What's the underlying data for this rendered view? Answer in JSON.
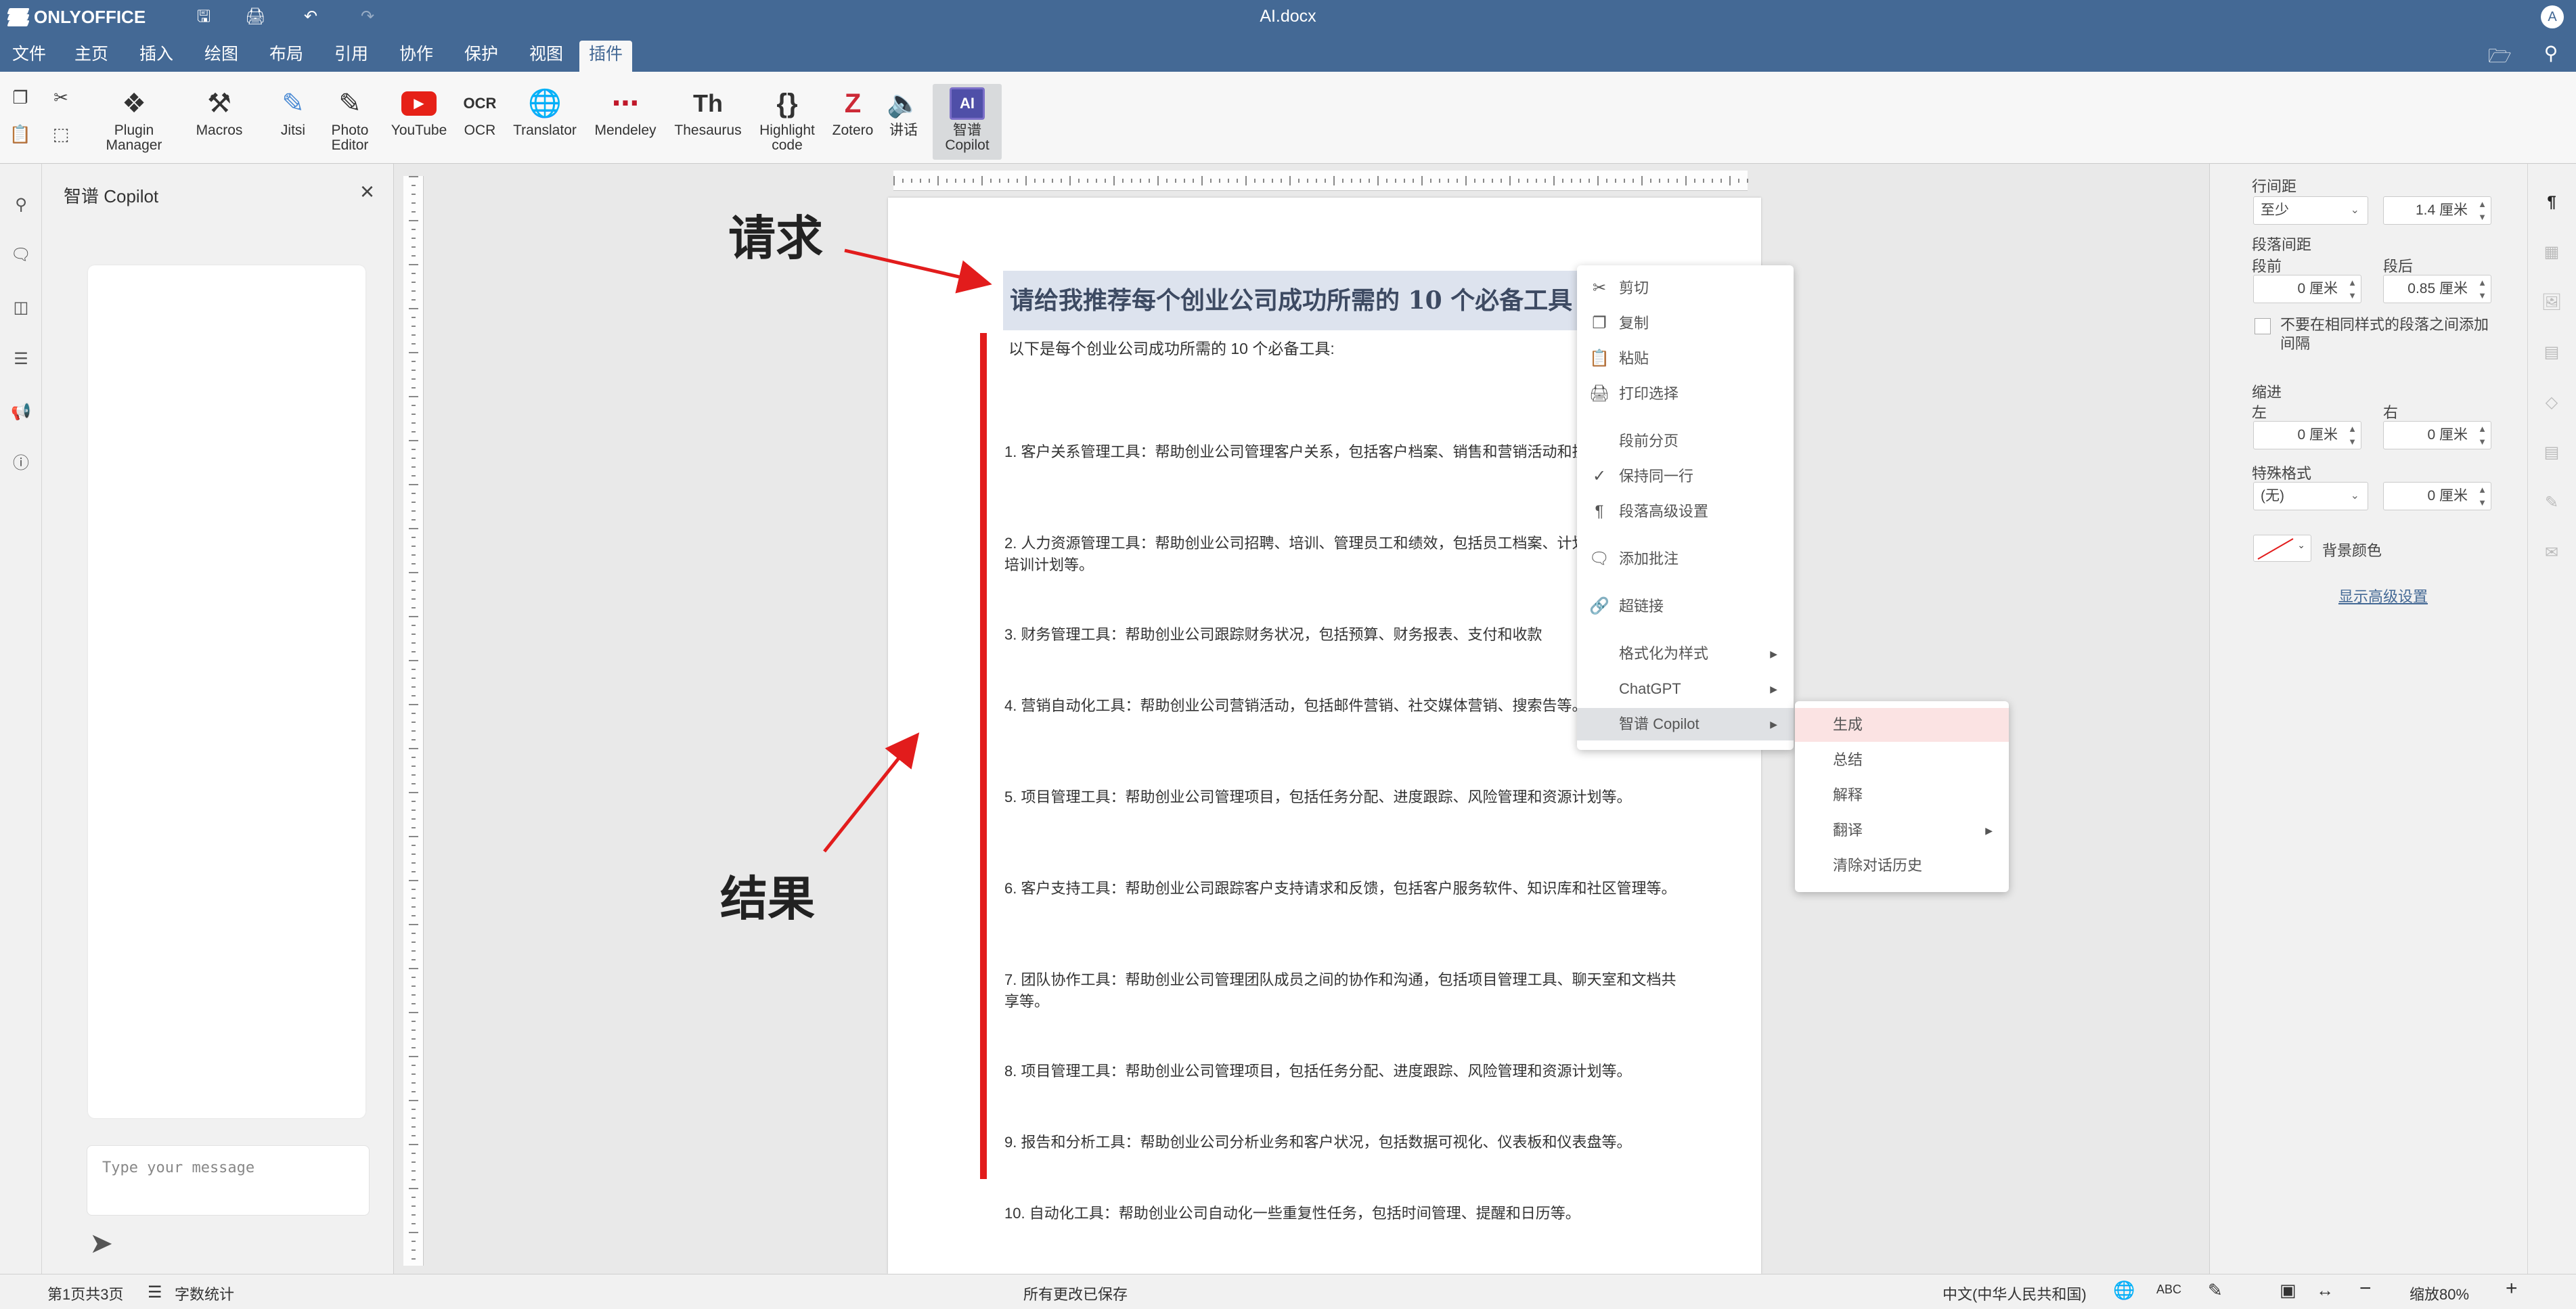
{
  "app": {
    "logo": "ONLYOFFICE",
    "doc_title": "AI.docx",
    "avatar": "A"
  },
  "quick_access": {
    "save_icon": "save-icon",
    "print_icon": "print-icon",
    "undo_icon": "undo-icon",
    "redo_icon": "redo-icon"
  },
  "menu_tabs": [
    "文件",
    "主页",
    "插入",
    "绘图",
    "布局",
    "引用",
    "协作",
    "保护",
    "视图",
    "插件"
  ],
  "active_tab": "插件",
  "toolbar": {
    "plugin_manager": "Plugin Manager",
    "macros": "Macros",
    "jitsi": "Jitsi",
    "photo_editor": "Photo Editor",
    "youtube": "YouTube",
    "ocr": "OCR",
    "translator": "Translator",
    "mendeley": "Mendeley",
    "thesaurus": "Thesaurus",
    "highlight_code": "Highlight code",
    "zotero": "Zotero",
    "speech": "讲话",
    "copilot": "智谱 Copilot",
    "ocr_glyph": "OCR",
    "th_glyph": "Th",
    "braces_glyph": "{}",
    "z_glyph": "Z",
    "ai_glyph": "AI"
  },
  "copilot_panel": {
    "title": "智谱 Copilot",
    "input_placeholder": "Type your message"
  },
  "document": {
    "heading": "请给我推荐每个创业公司成功所需的 10 个必备工具",
    "intro": "以下是每个创业公司成功所需的 10 个必备工具:",
    "items": [
      "1. 客户关系管理工具：帮助创业公司管理客户关系，包括客户档案、销售和营销活动和投诉等。",
      "2. 人力资源管理工具：帮助创业公司招聘、培训、管理员工和绩效，包括员工档案、计划、绩效评估和培训计划等。",
      "3. 财务管理工具：帮助创业公司跟踪财务状况，包括预算、财务报表、支付和收款",
      "4. 营销自动化工具：帮助创业公司营销活动，包括邮件营销、社交媒体营销、搜索告等。",
      "5. 项目管理工具：帮助创业公司管理项目，包括任务分配、进度跟踪、风险管理和资源计划等。",
      "6. 客户支持工具：帮助创业公司跟踪客户支持请求和反馈，包括客户服务软件、知识库和社区管理等。",
      "7. 团队协作工具：帮助创业公司管理团队成员之间的协作和沟通，包括项目管理工具、聊天室和文档共享等。",
      "8. 项目管理工具：帮助创业公司管理项目，包括任务分配、进度跟踪、风险管理和资源计划等。",
      "9. 报告和分析工具：帮助创业公司分析业务和客户状况，包括数据可视化、仪表板和仪表盘等。",
      "10. 自动化工具：帮助创业公司自动化一些重复性任务，包括时间管理、提醒和日历等。"
    ]
  },
  "annotations": {
    "request": "请求",
    "result": "结果",
    "color": "#e21c1c"
  },
  "context_menu": {
    "items": [
      {
        "label": "剪切",
        "icon": "scissors-icon"
      },
      {
        "label": "复制",
        "icon": "copy-icon"
      },
      {
        "label": "粘贴",
        "icon": "paste-icon"
      },
      {
        "label": "打印选择",
        "icon": "print-icon"
      },
      {
        "label": "段前分页",
        "icon": ""
      },
      {
        "label": "保持同一行",
        "icon": "check-icon"
      },
      {
        "label": "段落高级设置",
        "icon": "paragraph-icon"
      },
      {
        "label": "添加批注",
        "icon": "comment-icon"
      },
      {
        "label": "超链接",
        "icon": "link-icon"
      },
      {
        "label": "格式化为样式",
        "icon": ""
      },
      {
        "label": "ChatGPT",
        "icon": ""
      },
      {
        "label": "智谱 Copilot",
        "icon": ""
      }
    ]
  },
  "submenu": {
    "items": [
      "生成",
      "总结",
      "解释",
      "翻译",
      "清除对话历史"
    ]
  },
  "right_panel": {
    "line_spacing_label": "行间距",
    "line_spacing_mode": "至少",
    "line_spacing_value": "1.4 厘米",
    "para_spacing_label": "段落间距",
    "before_label": "段前",
    "after_label": "段后",
    "before_value": "0 厘米",
    "after_value": "0.85 厘米",
    "no_space_same_style": "不要在相同样式的段落之间添加间隔",
    "indent_label": "缩进",
    "left_label": "左",
    "right_label": "右",
    "left_value": "0 厘米",
    "right_value": "0 厘米",
    "special_label": "特殊格式",
    "special_mode": "(无)",
    "special_value": "0 厘米",
    "bg_color_label": "背景颜色",
    "advanced_link": "显示高级设置"
  },
  "status_bar": {
    "page_info": "第1页共3页",
    "word_count": "字数统计",
    "save_status": "所有更改已保存",
    "language": "中文(中华人民共和国)",
    "zoom": "缩放80%"
  }
}
